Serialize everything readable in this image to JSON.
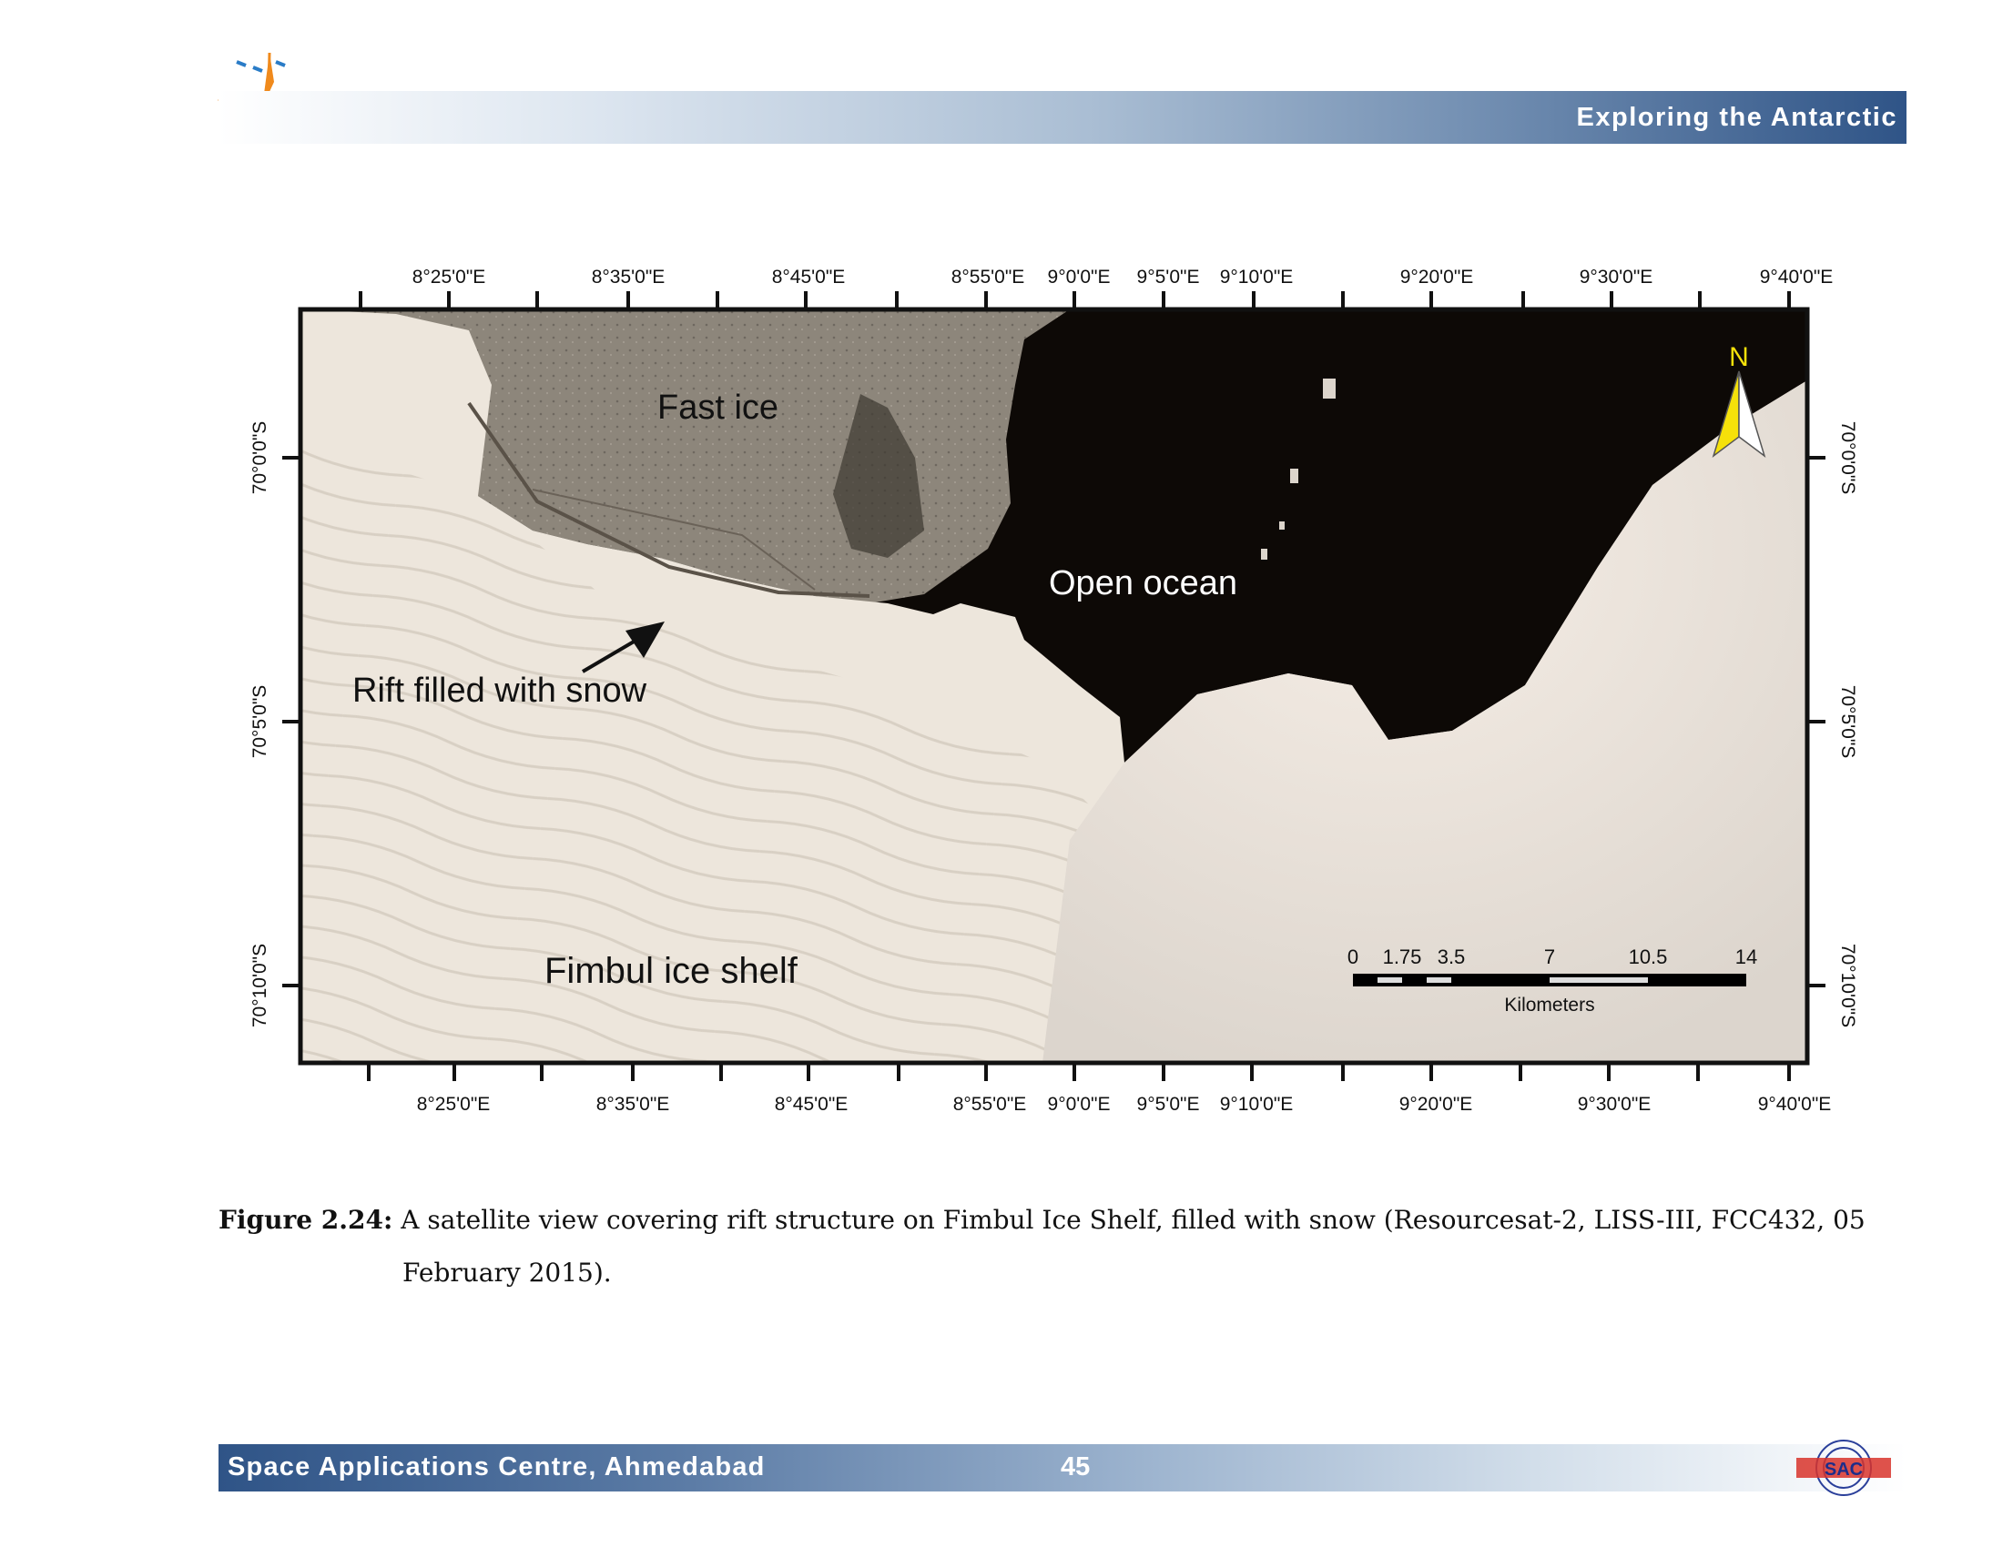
{
  "header": {
    "title": "Exploring the Antarctic",
    "logo_text": "इसरो isro"
  },
  "map": {
    "top_lon_labels": [
      "8°25'0\"E",
      "8°35'0\"E",
      "8°45'0\"E",
      "8°55'0\"E",
      "9°0'0\"E",
      "9°5'0\"E",
      "9°10'0\"E",
      "9°20'0\"E",
      "9°30'0\"E",
      "9°40'0\"E"
    ],
    "bottom_lon_labels": [
      "8°25'0\"E",
      "8°35'0\"E",
      "8°45'0\"E",
      "8°55'0\"E",
      "9°0'0\"E",
      "9°5'0\"E",
      "9°10'0\"E",
      "9°20'0\"E",
      "9°30'0\"E",
      "9°40'0\"E"
    ],
    "lat_labels": [
      "70°0'0\"S",
      "70°5'0\"S",
      "70°10'0\"S"
    ],
    "annotations": {
      "fast_ice": "Fast ice",
      "open_ocean": "Open ocean",
      "rift": "Rift filled with snow",
      "ice_shelf": "Fimbul ice shelf"
    },
    "north_arrow": "N",
    "scalebar": {
      "ticks": [
        "0",
        "1.75",
        "3.5",
        "7",
        "10.5",
        "14"
      ],
      "unit": "Kilometers"
    },
    "colors": {
      "ocean": "#0d0906",
      "fast_ice": "#8b8478",
      "shelf": "#ede6dc",
      "north_arrow": "#f5e10a"
    }
  },
  "caption": {
    "label": "Figure 2.24:",
    "text_line1": "A satellite view covering rift structure on Fimbul Ice Shelf, filled with snow (Resourcesat-2, LISS-III, FCC432, 05",
    "text_line2": "February 2015)."
  },
  "footer": {
    "org": "Space Applications Centre, Ahmedabad",
    "page": "45",
    "logo_text": "SAC"
  }
}
